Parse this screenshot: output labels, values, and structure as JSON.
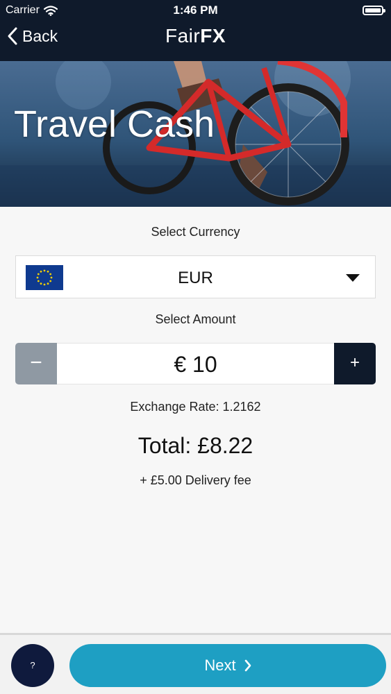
{
  "status_bar": {
    "carrier": "Carrier",
    "time": "1:46 PM"
  },
  "nav": {
    "back_label": "Back",
    "brand_prefix": "Fair",
    "brand_suffix": "FX"
  },
  "hero": {
    "title": "Travel Cash"
  },
  "currency": {
    "label": "Select Currency",
    "selected": "EUR"
  },
  "amount": {
    "label": "Select Amount",
    "value": "€ 10",
    "decrement_label": "−",
    "increment_label": "+"
  },
  "summary": {
    "exchange_rate": "Exchange Rate: 1.2162",
    "total": "Total: £8.22",
    "delivery_fee": "+ £5.00 Delivery fee"
  },
  "footer": {
    "help_label": "?",
    "next_label": "Next"
  },
  "colors": {
    "nav_background": "#0f1a2b",
    "next_button": "#1e9fc3",
    "help_button": "#0f1a3d",
    "minus_button": "#8f99a3"
  }
}
